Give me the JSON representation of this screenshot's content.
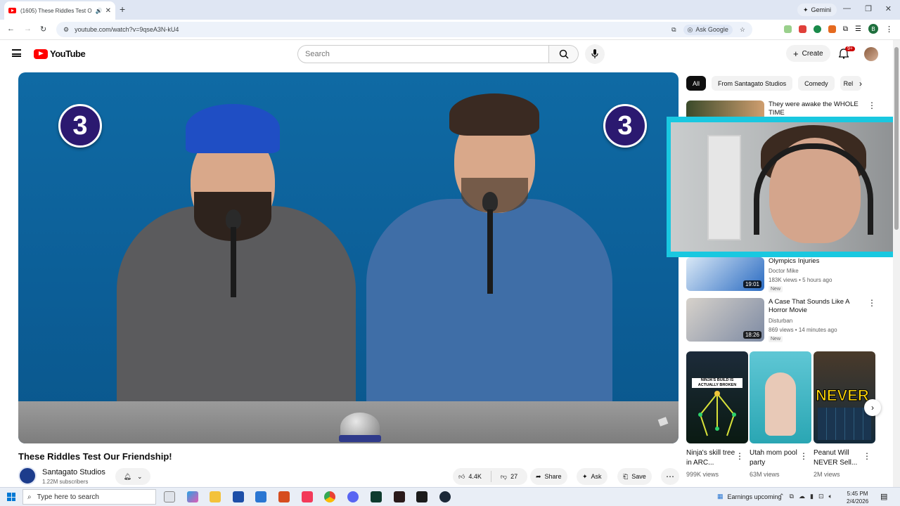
{
  "browser": {
    "tab_title": "(1605) These Riddles Test O",
    "new_tab": "+",
    "gemini_label": "Gemini",
    "url": "youtube.com/watch?v=9qseA3N-kU4",
    "ask_google": "Ask Google",
    "profile_initial": "B",
    "window_controls": [
      "—",
      "❐",
      "✕"
    ]
  },
  "youtube": {
    "logo_text": "YouTube",
    "search_placeholder": "Search",
    "create_label": "Create",
    "notification_count": "9+"
  },
  "video": {
    "badge_left": "3",
    "badge_right": "3",
    "title": "These Riddles Test Our Friendship!",
    "channel": "Santagato Studios",
    "subscribers": "1.22M subscribers",
    "likes": "4.4K",
    "dislikes": "27",
    "share": "Share",
    "ask": "Ask",
    "save": "Save"
  },
  "chips": [
    "All",
    "From Santagato Studios",
    "Comedy",
    "Rel"
  ],
  "recommendations": [
    {
      "title": "They were awake the WHOLE TIME",
      "channel": "",
      "meta": "",
      "duration": "",
      "new": ""
    },
    {
      "title": "Olympics Injuries",
      "channel": "Doctor Mike",
      "meta": "183K views • 5 hours ago",
      "duration": "19:01",
      "new": "New"
    },
    {
      "title": "A Case That Sounds Like A Horror Movie",
      "channel": "Disturban",
      "meta": "869 views • 14 minutes ago",
      "duration": "18:26",
      "new": "New"
    }
  ],
  "shorts": [
    {
      "title": "Ninja's skill tree in ARC...",
      "views": "999K views",
      "thumb_text": "NINJA'S BUILD IS ACTUALLY BROKEN"
    },
    {
      "title": "Utah mom pool party",
      "views": "63M views",
      "thumb_text": ""
    },
    {
      "title": "Peanut Will NEVER Sell...",
      "views": "2M views",
      "thumb_text": "NEVER"
    }
  ],
  "taskbar": {
    "search_placeholder": "Type here to search",
    "weather": "Earnings upcoming",
    "time": "5:45 PM",
    "date": "2/4/2026"
  },
  "colors": {
    "youtube_red": "#ff0000",
    "webcam_border": "#19c8e0",
    "backdrop_blue": "#0c5e97",
    "badge_purple": "#2b1970"
  }
}
